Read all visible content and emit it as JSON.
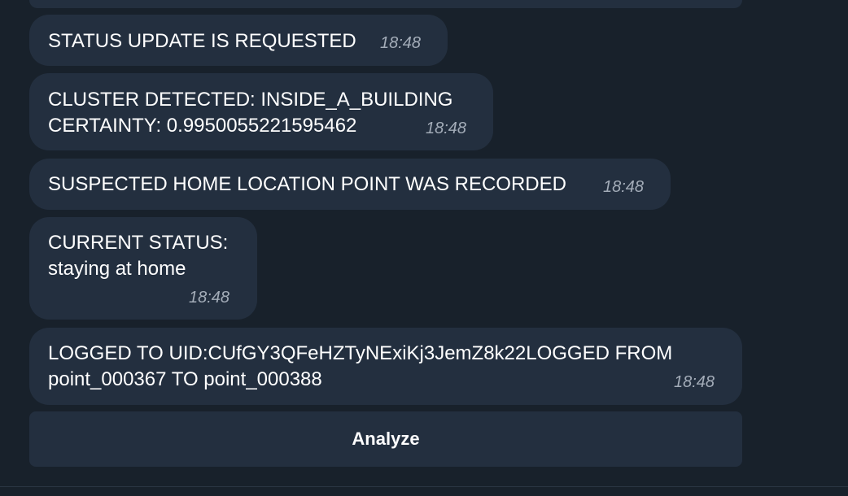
{
  "messages": [
    {
      "lines": [
        "STATUS UPDATE IS REQUESTED"
      ],
      "time": "18:48"
    },
    {
      "lines": [
        "CLUSTER DETECTED: INSIDE_A_BUILDING",
        "CERTAINTY: 0.9950055221595462"
      ],
      "time": "18:48"
    },
    {
      "lines": [
        "SUSPECTED HOME LOCATION POINT WAS RECORDED"
      ],
      "time": "18:48"
    },
    {
      "lines": [
        "CURRENT STATUS:",
        "staying at home"
      ],
      "time": "18:48"
    },
    {
      "lines": [
        "LOGGED TO UID:CUfGY3QFeHZTyNExiKj3JemZ8k22LOGGED FROM",
        "point_000367 TO point_000388"
      ],
      "time": "18:48"
    }
  ],
  "keyboard": {
    "analyze_label": "Analyze"
  },
  "colors": {
    "background": "#18212b",
    "bubble": "#232f3f",
    "time_text": "#a3acb8"
  }
}
